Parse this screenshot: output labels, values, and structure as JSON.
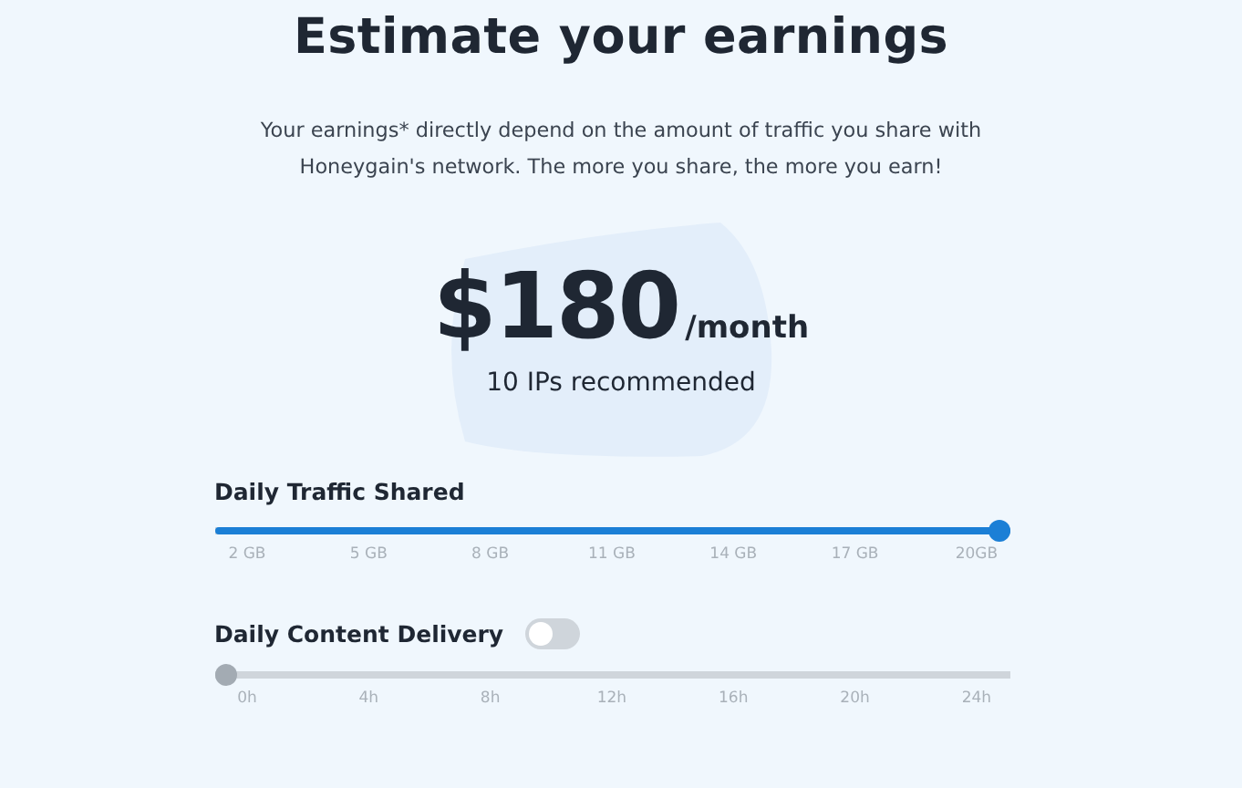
{
  "title": "Estimate your earnings",
  "description": "Your earnings* directly depend on the amount of traffic you share with Honeygain's network. The more you share, the more you earn!",
  "estimate": {
    "amount": "$180",
    "period": "/month",
    "note": "10 IPs recommended"
  },
  "sliders": [
    {
      "label": "Daily Traffic Shared",
      "level": 1,
      "ticks": [
        "2 GB",
        "5 GB",
        "8 GB",
        "11 GB",
        "14 GB",
        "17 GB",
        "20GB"
      ]
    },
    {
      "label": "Daily Content Delivery",
      "toggle": {
        "on": false
      },
      "level": 0,
      "ticks": [
        "0h",
        "4h",
        "8h",
        "12h",
        "16h",
        "20h",
        "24h"
      ]
    }
  ]
}
